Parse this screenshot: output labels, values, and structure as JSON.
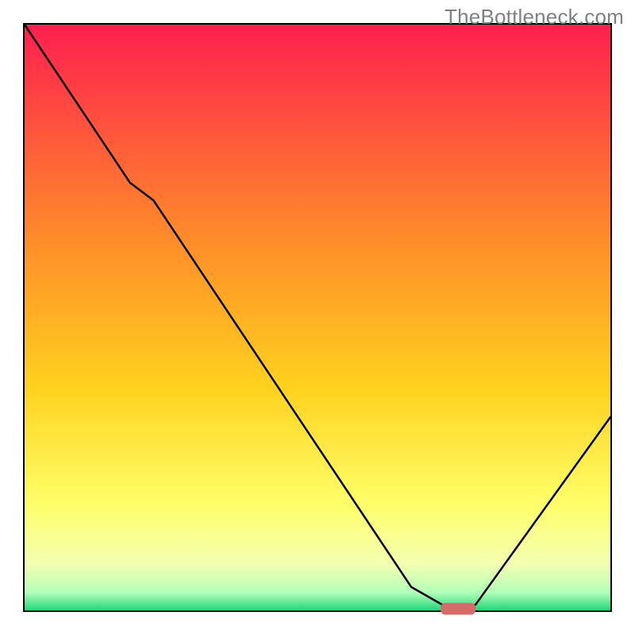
{
  "watermark": "TheBottleneck.com",
  "chart_data": {
    "type": "line",
    "title": "",
    "xlabel": "",
    "ylabel": "",
    "xlim": [
      0,
      100
    ],
    "ylim": [
      0,
      100
    ],
    "axes_visible": false,
    "grid": false,
    "gradient_background": {
      "stops": [
        {
          "offset": 0.0,
          "color": "#ff1f4f"
        },
        {
          "offset": 0.36,
          "color": "#ff8a2a"
        },
        {
          "offset": 0.62,
          "color": "#ffd21e"
        },
        {
          "offset": 0.82,
          "color": "#ffff6a"
        },
        {
          "offset": 0.92,
          "color": "#f4ffb0"
        },
        {
          "offset": 0.97,
          "color": "#b0ffb8"
        },
        {
          "offset": 1.0,
          "color": "#1fd67a"
        }
      ]
    },
    "series": [
      {
        "name": "bottleneck-curve",
        "color": "#000000",
        "x": [
          0,
          18,
          22,
          66,
          73,
          75,
          77,
          100
        ],
        "values": [
          100,
          73,
          70,
          4,
          0,
          0,
          1,
          33
        ]
      }
    ],
    "marker": {
      "name": "optimal-point",
      "x": 74,
      "y": 0,
      "color": "#d46a6a",
      "width": 6,
      "height": 2
    }
  }
}
